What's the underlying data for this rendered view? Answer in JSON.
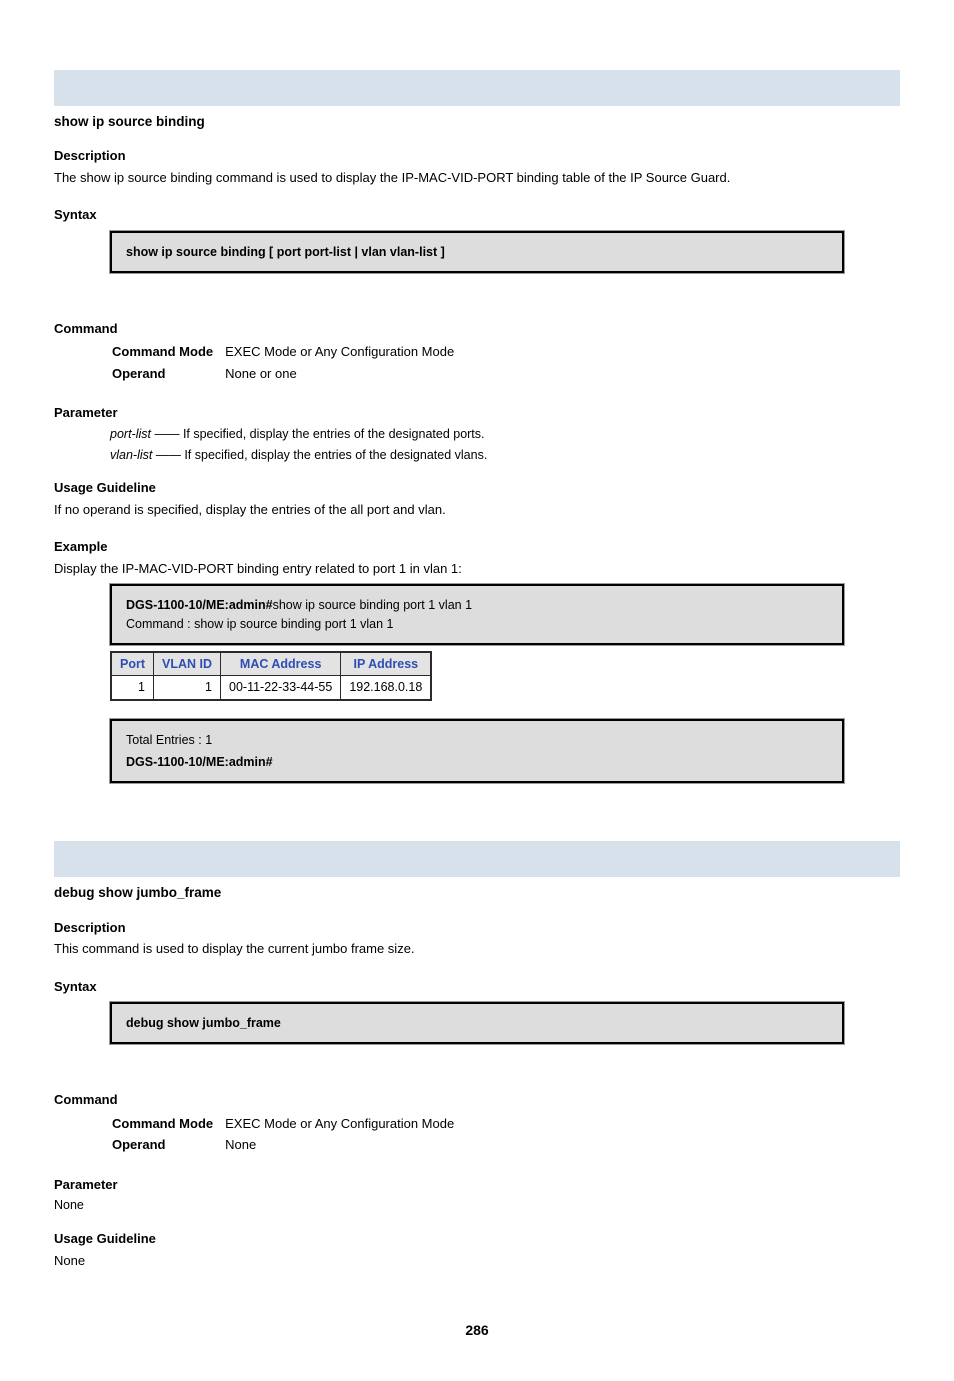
{
  "section1": {
    "title": "show ip source binding",
    "banner_sub": "Description",
    "desc_sub": "The show ip source binding command is used to display the IP-MAC-VID-PORT binding table of the IP Source Guard.",
    "syntax_head": "Syntax",
    "syntax": "show ip source binding [ port port-list | vlan vlan-list ]",
    "command_head": "Command",
    "cmd_label_1": "Command Mode",
    "cmd_val_1": "EXEC Mode or Any Configuration Mode",
    "cmd_label_2": "Operand",
    "cmd_val_2": "None or one",
    "param_head": "Parameter",
    "p1_name": "port-list",
    "p1_dash": " —— ",
    "p1_desc": "If specified, display the entries of the designated ports.",
    "p2_name": "vlan-list",
    "p2_dash": " —— ",
    "p2_desc": "If specified, display the entries of the designated vlans.",
    "usage_head": "Usage Guideline",
    "usage_body": "If no operand is specified, display the entries of the all port and vlan.",
    "example_head": "Example",
    "example_lead": "Display the IP-MAC-VID-PORT binding entry related to port 1 in vlan 1:",
    "code1_line1_a": "DGS-1100-10/ME:admin#",
    "code1_line1_b": "show ip source binding port 1 vlan 1",
    "code1_line2": "Command : show ip source binding port 1 vlan 1",
    "tbl": {
      "h1": "Port",
      "h2": "VLAN ID",
      "h3": "MAC Address",
      "h4": "IP Address",
      "r1c1": "1",
      "r1c2": "1",
      "r1c3": "00-11-22-33-44-55",
      "r1c4": "192.168.0.18"
    },
    "code2_line1": "Total Entries : 1",
    "code2_line2": "DGS-1100-10/ME:admin#"
  },
  "section2": {
    "title": "debug show jumbo_frame",
    "banner_sub": "Description",
    "desc_sub": "This command is used to display the current jumbo frame size.",
    "syntax_head": "Syntax",
    "syntax": "debug show jumbo_frame",
    "command_head": "Command",
    "cmd_label_1": "Command Mode",
    "cmd_val_1": "EXEC Mode or Any Configuration Mode",
    "cmd_label_2": "Operand",
    "cmd_val_2": "None",
    "param_head": "Parameter",
    "param_body": "None",
    "usage_head": "Usage Guideline",
    "usage_body": "None"
  },
  "footer": "286"
}
